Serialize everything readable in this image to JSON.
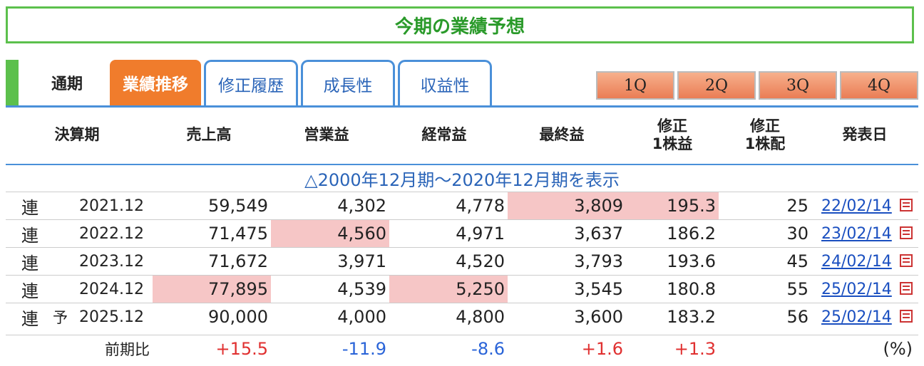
{
  "title": "今期の業績予想",
  "tabs": {
    "period": "通期",
    "active": "業績推移",
    "revision": "修正履歴",
    "growth": "成長性",
    "profitability": "収益性"
  },
  "quarters": [
    "1Q",
    "2Q",
    "3Q",
    "4Q"
  ],
  "columns": {
    "period": "決算期",
    "sales": "売上高",
    "operating": "営業益",
    "ordinary": "経常益",
    "net": "最終益",
    "eps_line1": "修正",
    "eps_line2": "1株益",
    "div_line1": "修正",
    "div_line2": "1株配",
    "date": "発表日"
  },
  "expand_link": "△2000年12月期～2020年12月期を表示",
  "rows": [
    {
      "type": "連",
      "forecast": "",
      "period": "2021.12",
      "sales": "59,549",
      "operating": "4,302",
      "ordinary": "4,778",
      "net": "3,809",
      "eps": "195.3",
      "div": "25",
      "date": "22/02/14"
    },
    {
      "type": "連",
      "forecast": "",
      "period": "2022.12",
      "sales": "71,475",
      "operating": "4,560",
      "ordinary": "4,971",
      "net": "3,637",
      "eps": "186.2",
      "div": "30",
      "date": "23/02/14"
    },
    {
      "type": "連",
      "forecast": "",
      "period": "2023.12",
      "sales": "71,672",
      "operating": "3,971",
      "ordinary": "4,520",
      "net": "3,793",
      "eps": "193.6",
      "div": "45",
      "date": "24/02/14"
    },
    {
      "type": "連",
      "forecast": "",
      "period": "2024.12",
      "sales": "77,895",
      "operating": "4,539",
      "ordinary": "5,250",
      "net": "3,545",
      "eps": "180.8",
      "div": "55",
      "date": "25/02/14"
    },
    {
      "type": "連",
      "forecast": "予",
      "period": "2025.12",
      "sales": "90,000",
      "operating": "4,000",
      "ordinary": "4,800",
      "net": "3,600",
      "eps": "183.2",
      "div": "56",
      "date": "25/02/14"
    }
  ],
  "yoy": {
    "label": "前期比",
    "sales": "+15.5",
    "operating": "-11.9",
    "ordinary": "-8.6",
    "net": "+1.6",
    "eps": "+1.3",
    "unit": "(%)"
  },
  "colors": {
    "accent_green": "#5cc04c",
    "tab_orange": "#f07c2c",
    "link_blue": "#2a64b8",
    "highlight": "#f6c6c6",
    "positive": "#e03030",
    "negative": "#2a64d8"
  }
}
